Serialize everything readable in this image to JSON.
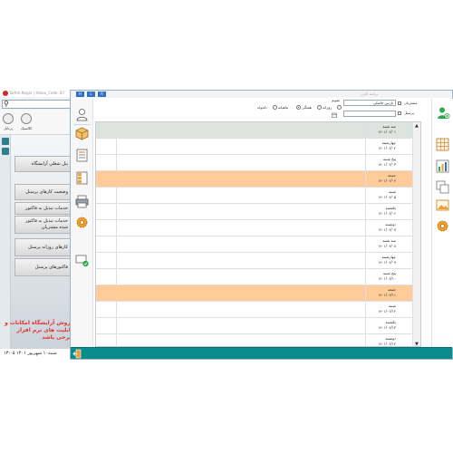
{
  "background_app": {
    "title": "Tarfeh Negar | Halou_Code: 87",
    "search_placeholder": "",
    "toolbar": [
      {
        "label": "کلاسیک",
        "icon": "clock-icon"
      },
      {
        "label": "پرتابل",
        "icon": "portable-icon"
      }
    ],
    "menu_buttons": [
      {
        "label": "پنل شغلي آرايشگاه"
      },
      {
        "label": "وضعیت کارهای پرسنل"
      },
      {
        "label": "خدمات تبدیل به فاکتور شده"
      },
      {
        "label": "خدمات تبدیل به فاکتور شده مشتریان"
      },
      {
        "label": "کارهای روزانه پرسنل"
      },
      {
        "label": "فاکتورهای پرسنل"
      }
    ],
    "promo_text": "فروش آرایشگاه  امکانات و قابلیت های نرم افزار  طرحی باشد",
    "status_text": "شنبه۱۰ شهریور ۱۴۰۱  ۱۳:۰۵"
  },
  "main_window": {
    "caption": "برنامه کاری",
    "window_buttons": [
      "H",
      "L",
      "R"
    ],
    "filters": {
      "customer_label": "مشتریان",
      "customer_value": "نازنین فاضلی",
      "personnel_label": "پرسنل",
      "personnel_value": "",
      "view_label": "تقویم",
      "view_options": [
        "روزانه",
        "هفتگی",
        "ماهیانه",
        "دلخواه"
      ],
      "selected_view": "ماهیانه"
    },
    "rows": [
      {
        "day": "سه شنبه",
        "date": "۱۴۰۱/۰۶/۰۱",
        "highlight": "gray"
      },
      {
        "day": "چهارشنبه",
        "date": "۱۴۰۱/۰۶/۰۲",
        "highlight": "none"
      },
      {
        "day": "پنج شنبه",
        "date": "۱۴۰۱/۰۶/۰۳",
        "highlight": "none"
      },
      {
        "day": "جمعه",
        "date": "۱۴۰۱/۰۶/۰۴",
        "highlight": "orange"
      },
      {
        "day": "شنبه",
        "date": "۱۴۰۱/۰۶/۰۵",
        "highlight": "none"
      },
      {
        "day": "یکشنبه",
        "date": "۱۴۰۱/۰۶/۰۶",
        "highlight": "none"
      },
      {
        "day": "دوشنبه",
        "date": "۱۴۰۱/۰۶/۰۷",
        "highlight": "none"
      },
      {
        "day": "سه شنبه",
        "date": "۱۴۰۱/۰۶/۰۸",
        "highlight": "none"
      },
      {
        "day": "چهارشنبه",
        "date": "۱۴۰۱/۰۶/۰۹",
        "highlight": "none"
      },
      {
        "day": "پنج شنبه",
        "date": "۱۴۰۱/۰۶/۱۰",
        "highlight": "none"
      },
      {
        "day": "جمعه",
        "date": "۱۴۰۱/۰۶/۱۱",
        "highlight": "orange"
      },
      {
        "day": "شنبه",
        "date": "۱۴۰۱/۰۶/۱۲",
        "highlight": "none"
      },
      {
        "day": "یکشنبه",
        "date": "۱۴۰۱/۰۶/۱۳",
        "highlight": "none"
      },
      {
        "day": "دوشنبه",
        "date": "۱۴۰۱/۰۶/۱۴",
        "highlight": "none"
      }
    ],
    "colors": {
      "highlight_gray": "#dfe3df",
      "highlight_orange": "#ffcc99",
      "bottom_bar": "#0b8c8c",
      "title_button": "#2f71c9"
    },
    "left_toolbar_icons": [
      "person-icon",
      "box-icon",
      "list-icon",
      "panel-icon",
      "printer-icon",
      "gear-icon",
      "chat-check-icon"
    ],
    "right_toolbar_icons": [
      "add-user-icon",
      "grid-icon",
      "bar-chart-icon",
      "copy-icon",
      "image-icon",
      "gear-icon"
    ]
  }
}
